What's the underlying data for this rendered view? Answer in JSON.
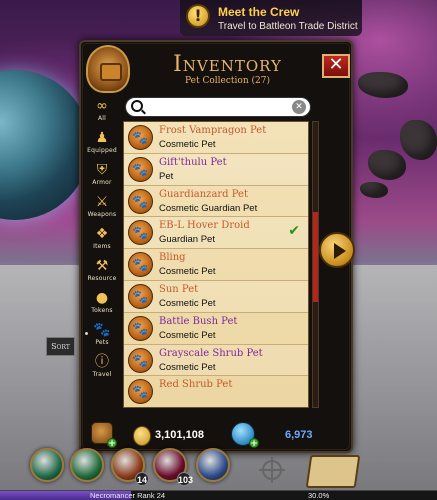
{
  "quest": {
    "badge": "!",
    "title": "Meet the Crew",
    "subtitle": "Travel to Battleon Trade District"
  },
  "inventory": {
    "title": "Inventory",
    "subtitle": "Pet Collection (27)",
    "close_label": "✕",
    "search": {
      "placeholder": "",
      "value": "",
      "clear_label": "✕"
    },
    "sort_label": "Sort",
    "categories": [
      {
        "label": "All",
        "icon": "infinity-icon",
        "glyph": "∞"
      },
      {
        "label": "Equipped",
        "icon": "equipped-icon",
        "glyph": "♟"
      },
      {
        "label": "Armor",
        "icon": "armor-icon",
        "glyph": "⛨"
      },
      {
        "label": "Weapons",
        "icon": "sword-icon",
        "glyph": "⚔"
      },
      {
        "label": "Items",
        "icon": "items-icon",
        "glyph": "❖"
      },
      {
        "label": "Resource",
        "icon": "resource-icon",
        "glyph": "⚒"
      },
      {
        "label": "Tokens",
        "icon": "token-icon",
        "glyph": "●"
      },
      {
        "label": "Pets",
        "icon": "paw-icon",
        "glyph": "🐾"
      },
      {
        "label": "Travel",
        "icon": "travel-icon",
        "glyph": "ⓘ"
      }
    ],
    "active_category": 7,
    "items": [
      {
        "name": "Frost Vampragon Pet",
        "type": "Cosmetic Pet",
        "name_color": "#c45a2a",
        "equipped": false
      },
      {
        "name": "Gift'thulu Pet",
        "type": "Pet",
        "name_color": "#7a2a9a",
        "equipped": false
      },
      {
        "name": "Guardianzard Pet",
        "type": "Cosmetic Guardian Pet",
        "name_color": "#c45a2a",
        "equipped": false
      },
      {
        "name": "EB-L Hover Droid",
        "type": "Guardian Pet",
        "name_color": "#c45a2a",
        "equipped": true
      },
      {
        "name": "Bling",
        "type": "Cosmetic Pet",
        "name_color": "#c45a2a",
        "equipped": false
      },
      {
        "name": "Sun Pet",
        "type": "Cosmetic Pet",
        "name_color": "#c45a2a",
        "equipped": false
      },
      {
        "name": "Battle Bush Pet",
        "type": "Cosmetic Pet",
        "name_color": "#7a2a9a",
        "equipped": false
      },
      {
        "name": "Grayscale Shrub Pet",
        "type": "Cosmetic Pet",
        "name_color": "#7a2a9a",
        "equipped": false
      },
      {
        "name": "Red Shrub Pet",
        "type": "",
        "name_color": "#c45a2a",
        "equipped": false
      }
    ],
    "equipped_mark": "✔",
    "currency": {
      "gold": "3,101,108",
      "adventure_coins": "6,973",
      "add_label": "+"
    }
  },
  "hud": {
    "skills": [
      {
        "icon": "skill-1-icon",
        "color": "#1f6a4a",
        "badge": ""
      },
      {
        "icon": "skill-2-icon",
        "color": "#1f6a3a",
        "badge": ""
      },
      {
        "icon": "skill-3-icon",
        "color": "#8a3a1a",
        "badge": "14"
      },
      {
        "icon": "skill-4-icon",
        "color": "#6a0a2a",
        "badge": "103"
      },
      {
        "icon": "skill-5-icon",
        "color": "#2a4a8a",
        "badge": ""
      }
    ],
    "xp": {
      "rank": "Necromancer Rank 24",
      "percent_text": "30.0%",
      "fill_fraction": 0.3
    }
  }
}
